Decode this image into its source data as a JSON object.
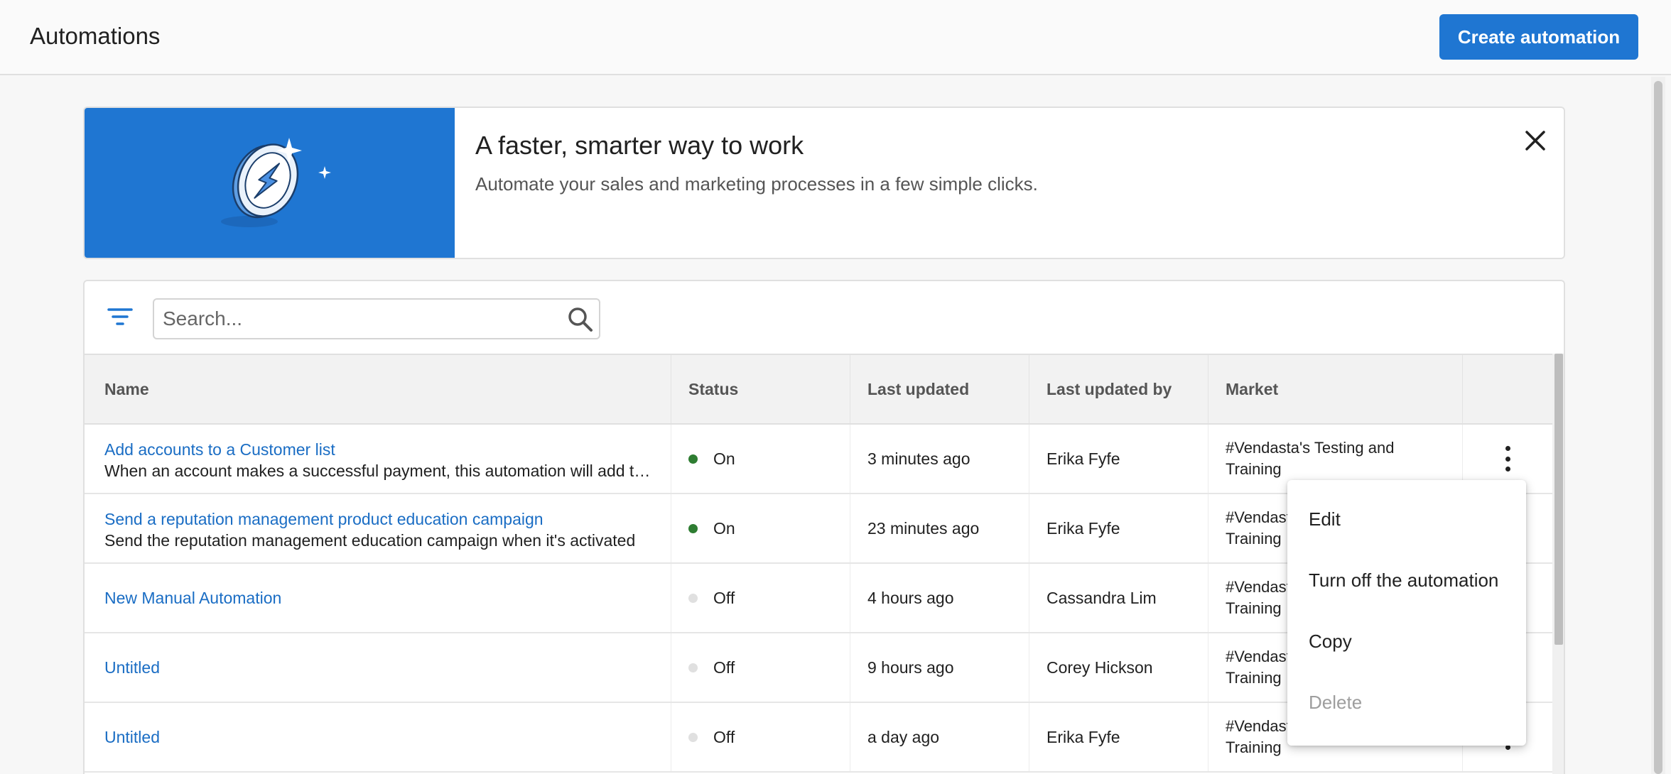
{
  "header": {
    "title": "Automations",
    "create_label": "Create automation"
  },
  "banner": {
    "title": "A faster, smarter way to work",
    "subtitle": "Automate your sales and marketing processes in a few simple clicks."
  },
  "toolbar": {
    "search_placeholder": "Search...",
    "search_value": ""
  },
  "table": {
    "columns": [
      "Name",
      "Status",
      "Last updated",
      "Last updated by",
      "Market"
    ],
    "rows": [
      {
        "name": "Add accounts to a Customer list",
        "description": "When an account makes a successful payment, this automation will add the account to a Customer list",
        "status": "On",
        "last_updated": "3 minutes ago",
        "updated_by": "Erika Fyfe",
        "market_line1": "#Vendasta's Testing and",
        "market_line2": "Training"
      },
      {
        "name": "Send a reputation management product education campaign",
        "description": "Send the reputation management education campaign when it's activated",
        "status": "On",
        "last_updated": "23 minutes ago",
        "updated_by": "Erika Fyfe",
        "market_line1": "#Vendasta's Testing and",
        "market_line2": "Training"
      },
      {
        "name": "New Manual Automation",
        "description": "",
        "status": "Off",
        "last_updated": "4 hours ago",
        "updated_by": "Cassandra Lim",
        "market_line1": "#Vendasta's Testing and",
        "market_line2": "Training"
      },
      {
        "name": "Untitled",
        "description": "",
        "status": "Off",
        "last_updated": "9 hours ago",
        "updated_by": "Corey Hickson",
        "market_line1": "#Vendasta's Testing and",
        "market_line2": "Training"
      },
      {
        "name": "Untitled",
        "description": "",
        "status": "Off",
        "last_updated": "a day ago",
        "updated_by": "Erika Fyfe",
        "market_line1": "#Vendasta's Testing and",
        "market_line2": "Training"
      }
    ]
  },
  "context_menu": {
    "items": [
      {
        "label": "Edit",
        "disabled": false
      },
      {
        "label": "Turn off the automation",
        "disabled": false
      },
      {
        "label": "Copy",
        "disabled": false
      },
      {
        "label": "Delete",
        "disabled": true
      }
    ]
  },
  "colors": {
    "primary": "#1f76d2",
    "link": "#1a6dc4",
    "status_on": "#2e7d32",
    "status_off": "#e0e0e0"
  }
}
